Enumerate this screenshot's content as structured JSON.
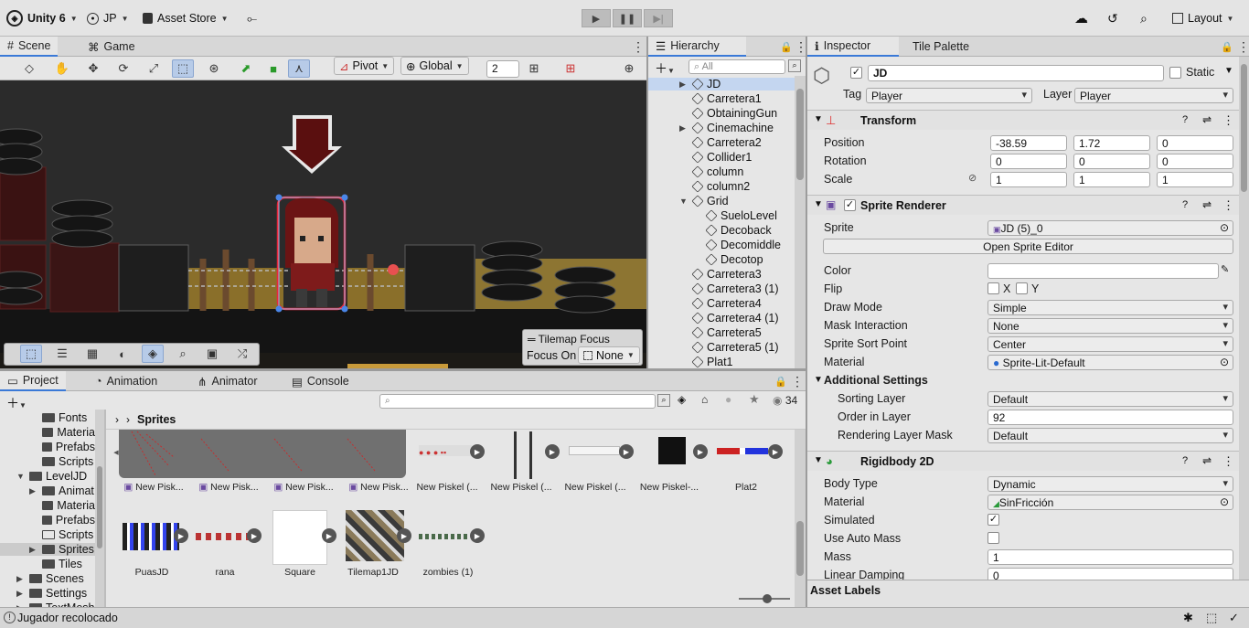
{
  "topbar": {
    "app": "Unity 6",
    "account": "JP",
    "asset_store": "Asset Store",
    "layout": "Layout"
  },
  "scene_tabs": {
    "scene": "Scene",
    "game": "Game"
  },
  "scene_toolbar": {
    "pivot": "Pivot",
    "global": "Global",
    "grid_size": "2"
  },
  "tilemap_focus": {
    "title": "Tilemap Focus",
    "focus_on_label": "Focus On",
    "focus_value": "None"
  },
  "hierarchy": {
    "title": "Hierarchy",
    "search_placeholder": "All",
    "items": [
      {
        "label": "JD",
        "indent": 0,
        "expand": true,
        "selected": true
      },
      {
        "label": "Carretera1",
        "indent": 0
      },
      {
        "label": "ObtainingGun",
        "indent": 0
      },
      {
        "label": "Cinemachine",
        "indent": 0,
        "expand": true
      },
      {
        "label": "Carretera2",
        "indent": 0
      },
      {
        "label": "Collider1",
        "indent": 0
      },
      {
        "label": "column",
        "indent": 0
      },
      {
        "label": "column2",
        "indent": 0
      },
      {
        "label": "Grid",
        "indent": 0,
        "open": true
      },
      {
        "label": "SueloLevel",
        "indent": 1
      },
      {
        "label": "Decoback",
        "indent": 1
      },
      {
        "label": "Decomiddle",
        "indent": 1
      },
      {
        "label": "Decotop",
        "indent": 1
      },
      {
        "label": "Carretera3",
        "indent": 0
      },
      {
        "label": "Carretera3 (1)",
        "indent": 0
      },
      {
        "label": "Carretera4",
        "indent": 0
      },
      {
        "label": "Carretera4 (1)",
        "indent": 0
      },
      {
        "label": "Carretera5",
        "indent": 0
      },
      {
        "label": "Carretera5 (1)",
        "indent": 0
      },
      {
        "label": "Plat1",
        "indent": 0
      }
    ]
  },
  "project_tabs": {
    "project": "Project",
    "animation": "Animation",
    "animator": "Animator",
    "console": "Console"
  },
  "project": {
    "hidden_count": "34",
    "breadcrumb": "Sprites",
    "tree": [
      {
        "label": "Fonts",
        "depth": 2
      },
      {
        "label": "Materia",
        "depth": 2
      },
      {
        "label": "Prefabs",
        "depth": 2
      },
      {
        "label": "Scripts",
        "depth": 2
      },
      {
        "label": "LevelJD",
        "depth": 1,
        "open": true
      },
      {
        "label": "Animat",
        "depth": 2,
        "expand": true
      },
      {
        "label": "Materia",
        "depth": 2
      },
      {
        "label": "Prefabs",
        "depth": 2
      },
      {
        "label": "Scripts",
        "depth": 2,
        "empty": true
      },
      {
        "label": "Sprites",
        "depth": 2,
        "expand": true,
        "selected": true
      },
      {
        "label": "Tiles",
        "depth": 2
      },
      {
        "label": "Scenes",
        "depth": 1,
        "expand": true
      },
      {
        "label": "Settings",
        "depth": 1,
        "expand": true
      },
      {
        "label": "TextMesh",
        "depth": 1,
        "expand": true
      }
    ],
    "assets_row1": [
      "New Pisk...",
      "New Pisk...",
      "New Pisk...",
      "New Pisk...",
      "New Piskel (...",
      "New Piskel (...",
      "New Piskel (...",
      "New Piskel-...",
      "Plat2"
    ],
    "assets_row2": [
      "PuasJD",
      "rana",
      "Square",
      "Tilemap1JD",
      "zombies (1)"
    ]
  },
  "status": {
    "message": "Jugador recolocado"
  },
  "inspector": {
    "tabs": {
      "inspector": "Inspector",
      "tile_palette": "Tile Palette"
    },
    "object_name": "JD",
    "static_label": "Static",
    "tag_label": "Tag",
    "tag": "Player",
    "layer_label": "Layer",
    "layer": "Player",
    "transform": {
      "title": "Transform",
      "position_label": "Position",
      "position": [
        "-38.59",
        "1.72",
        "0"
      ],
      "rotation_label": "Rotation",
      "rotation": [
        "0",
        "0",
        "0"
      ],
      "scale_label": "Scale",
      "scale": [
        "1",
        "1",
        "1"
      ]
    },
    "sprite_renderer": {
      "title": "Sprite Renderer",
      "sprite_label": "Sprite",
      "sprite": "JD (5)_0",
      "open_editor": "Open Sprite Editor",
      "color_label": "Color",
      "flip_label": "Flip",
      "flip_x": "X",
      "flip_y": "Y",
      "draw_mode_label": "Draw Mode",
      "draw_mode": "Simple",
      "mask_label": "Mask Interaction",
      "mask": "None",
      "sort_point_label": "Sprite Sort Point",
      "sort_point": "Center",
      "material_label": "Material",
      "material": "Sprite-Lit-Default",
      "additional": "Additional Settings",
      "sorting_layer_label": "Sorting Layer",
      "sorting_layer": "Default",
      "order_label": "Order in Layer",
      "order": "92",
      "render_mask_label": "Rendering Layer Mask",
      "render_mask": "Default"
    },
    "rigidbody": {
      "title": "Rigidbody 2D",
      "body_type_label": "Body Type",
      "body_type": "Dynamic",
      "material_label": "Material",
      "material": "SinFricción",
      "simulated_label": "Simulated",
      "auto_mass_label": "Use Auto Mass",
      "mass_label": "Mass",
      "mass": "1",
      "linear_damping_label": "Linear Damping",
      "linear_damping": "0"
    },
    "asset_labels": "Asset Labels"
  },
  "colors": {
    "accent": "#3a79d7",
    "selection": "#c4d6f0",
    "outline": "#e8283c"
  }
}
